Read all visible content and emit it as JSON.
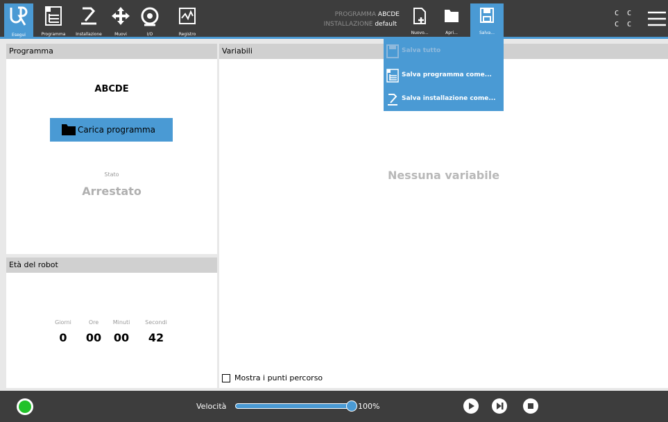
{
  "nav": {
    "run_label": "Esegui",
    "program_label": "Programma",
    "install_label": "Installazione",
    "move_label": "Muovi",
    "io_label": "I/O",
    "log_label": "Registro"
  },
  "header": {
    "program_key": "PROGRAMMA",
    "program_value": "ABCDE",
    "install_key": "INSTALLAZIONE",
    "install_value": "default"
  },
  "toolbar": {
    "new_label": "Nuovo...",
    "open_label": "Apri...",
    "save_label": "Salva...",
    "cc_top": "C C",
    "cc_bottom": "C C"
  },
  "save_menu": {
    "items": [
      {
        "label": "Salva tutto",
        "enabled": false
      },
      {
        "label": "Salva programma come...",
        "enabled": true
      },
      {
        "label": "Salva installazione come...",
        "enabled": true
      }
    ]
  },
  "program_panel": {
    "title": "Programma",
    "program_name": "ABCDE",
    "load_button": "Carica programma",
    "state_label": "Stato",
    "state_value": "Arrestato"
  },
  "robot_age": {
    "title": "Età del robot",
    "labels": [
      "Giorni",
      "Ore",
      "Minuti",
      "Secondi"
    ],
    "values": [
      "0",
      "00",
      "00",
      "42"
    ]
  },
  "variables": {
    "title": "Variabili",
    "empty_text": "Nessuna variabile",
    "show_waypoints": "Mostra i punti percorso"
  },
  "footer": {
    "speed_label": "Velocità",
    "speed_value": "100%",
    "speed_fraction": 1.0,
    "status_color": "#22c22a"
  },
  "colors": {
    "accent": "#4a9ad4",
    "bar": "#3d3d3d"
  }
}
